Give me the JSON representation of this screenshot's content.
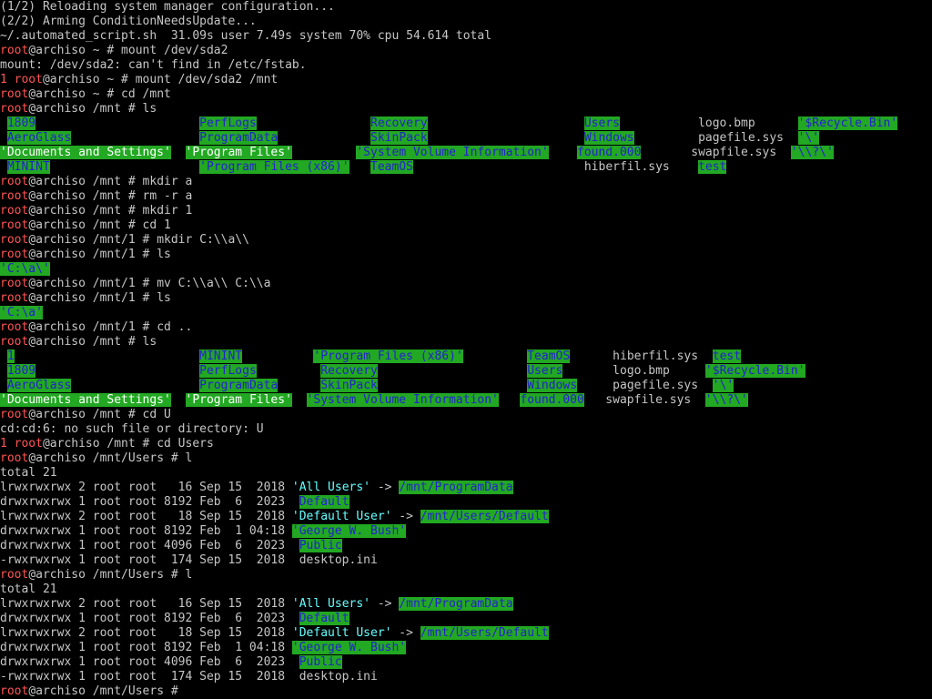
{
  "terminal": {
    "lines": [
      [
        {
          "t": "(1/2) Reloading system manager configuration..."
        }
      ],
      [
        {
          "t": "(2/2) Arming ConditionNeedsUpdate..."
        }
      ],
      [
        {
          "t": "~/.automated_script.sh  31.09s user 7.49s system 70% cpu 54.614 total"
        }
      ],
      [
        {
          "t": "root",
          "c": "user"
        },
        {
          "t": "@archiso ~ # mount /dev/sda2"
        }
      ],
      [
        {
          "t": "mount: /dev/sda2: can't find in /etc/fstab."
        }
      ],
      [
        {
          "t": "1 root",
          "c": "red"
        },
        {
          "t": "@archiso ~ # mount /dev/sda2 /mnt"
        }
      ],
      [
        {
          "t": "root",
          "c": "user"
        },
        {
          "t": "@archiso ~ # cd /mnt"
        }
      ],
      [
        {
          "t": "root",
          "c": "user"
        },
        {
          "t": "@archiso /mnt # ls"
        }
      ],
      [
        {
          "t": " "
        },
        {
          "t": "1809",
          "c": "dir"
        },
        {
          "t": "                       "
        },
        {
          "t": "PerfLogs",
          "c": "dir"
        },
        {
          "t": "                "
        },
        {
          "t": "Recovery",
          "c": "dir"
        },
        {
          "t": "                      "
        },
        {
          "t": "Users",
          "c": "dir"
        },
        {
          "t": "           logo.bmp      "
        },
        {
          "t": "'$Recycle.Bin'",
          "c": "dir"
        }
      ],
      [
        {
          "t": " "
        },
        {
          "t": "AeroGlass",
          "c": "dir"
        },
        {
          "t": "                  "
        },
        {
          "t": "ProgramData",
          "c": "dir"
        },
        {
          "t": "             "
        },
        {
          "t": "SkinPack",
          "c": "dir"
        },
        {
          "t": "                      "
        },
        {
          "t": "Windows",
          "c": "dir"
        },
        {
          "t": "         pagefile.sys  "
        },
        {
          "t": "'\\'",
          "c": "dir"
        }
      ],
      [
        {
          "t": "'Documents and Settings'",
          "c": "qdir"
        },
        {
          "t": "  "
        },
        {
          "t": "'Program Files'",
          "c": "qdir"
        },
        {
          "t": "         "
        },
        {
          "t": "'System Volume Information'",
          "c": "dir"
        },
        {
          "t": "    "
        },
        {
          "t": "found.000",
          "c": "dir"
        },
        {
          "t": "       swapfile.sys  "
        },
        {
          "t": "'\\\\?\\'",
          "c": "dir"
        }
      ],
      [
        {
          "t": " "
        },
        {
          "t": "MININT",
          "c": "dir"
        },
        {
          "t": "                     "
        },
        {
          "t": "'Program Files (x86)'",
          "c": "dir"
        },
        {
          "t": "   "
        },
        {
          "t": "TeamOS",
          "c": "dir"
        },
        {
          "t": "                        hiberfil.sys    "
        },
        {
          "t": "test",
          "c": "dir"
        }
      ],
      [
        {
          "t": "root",
          "c": "user"
        },
        {
          "t": "@archiso /mnt # mkdir a"
        }
      ],
      [
        {
          "t": "root",
          "c": "user"
        },
        {
          "t": "@archiso /mnt # rm -r a"
        }
      ],
      [
        {
          "t": "root",
          "c": "user"
        },
        {
          "t": "@archiso /mnt # mkdir 1"
        }
      ],
      [
        {
          "t": "root",
          "c": "user"
        },
        {
          "t": "@archiso /mnt # cd 1"
        }
      ],
      [
        {
          "t": "root",
          "c": "user"
        },
        {
          "t": "@archiso /mnt/1 # mkdir C:\\\\a\\\\"
        }
      ],
      [
        {
          "t": "root",
          "c": "user"
        },
        {
          "t": "@archiso /mnt/1 # ls"
        }
      ],
      [
        {
          "t": "'C:\\a\\'",
          "c": "dir"
        }
      ],
      [
        {
          "t": "root",
          "c": "user"
        },
        {
          "t": "@archiso /mnt/1 # mv C:\\\\a\\\\ C:\\\\a"
        }
      ],
      [
        {
          "t": "root",
          "c": "user"
        },
        {
          "t": "@archiso /mnt/1 # ls"
        }
      ],
      [
        {
          "t": "'C:\\a'",
          "c": "dir"
        }
      ],
      [
        {
          "t": "root",
          "c": "user"
        },
        {
          "t": "@archiso /mnt/1 # cd .."
        }
      ],
      [
        {
          "t": "root",
          "c": "user"
        },
        {
          "t": "@archiso /mnt # ls"
        }
      ],
      [
        {
          "t": " "
        },
        {
          "t": "1",
          "c": "dir"
        },
        {
          "t": "                          "
        },
        {
          "t": "MININT",
          "c": "dir"
        },
        {
          "t": "          "
        },
        {
          "t": "'Program Files (x86)'",
          "c": "dir"
        },
        {
          "t": "         "
        },
        {
          "t": "TeamOS",
          "c": "dir"
        },
        {
          "t": "      hiberfil.sys  "
        },
        {
          "t": "test",
          "c": "dir"
        }
      ],
      [
        {
          "t": " "
        },
        {
          "t": "1809",
          "c": "dir"
        },
        {
          "t": "                       "
        },
        {
          "t": "PerfLogs",
          "c": "dir"
        },
        {
          "t": "         "
        },
        {
          "t": "Recovery",
          "c": "dir"
        },
        {
          "t": "                     "
        },
        {
          "t": "Users",
          "c": "dir"
        },
        {
          "t": "       logo.bmp     "
        },
        {
          "t": "'$Recycle.Bin'",
          "c": "dir"
        }
      ],
      [
        {
          "t": " "
        },
        {
          "t": "AeroGlass",
          "c": "dir"
        },
        {
          "t": "                  "
        },
        {
          "t": "ProgramData",
          "c": "dir"
        },
        {
          "t": "      "
        },
        {
          "t": "SkinPack",
          "c": "dir"
        },
        {
          "t": "                     "
        },
        {
          "t": "Windows",
          "c": "dir"
        },
        {
          "t": "     pagefile.sys  "
        },
        {
          "t": "'\\'",
          "c": "dir"
        }
      ],
      [
        {
          "t": "'Documents and Settings'",
          "c": "qdir"
        },
        {
          "t": "  "
        },
        {
          "t": "'Program Files'",
          "c": "qdir"
        },
        {
          "t": "  "
        },
        {
          "t": "'System Volume Information'",
          "c": "dir"
        },
        {
          "t": "   "
        },
        {
          "t": "found.000",
          "c": "dir"
        },
        {
          "t": "   swapfile.sys  "
        },
        {
          "t": "'\\\\?\\'",
          "c": "dir"
        }
      ],
      [
        {
          "t": "root",
          "c": "user"
        },
        {
          "t": "@archiso /mnt # cd U"
        }
      ],
      [
        {
          "t": "cd:cd:6: no such file or directory: U"
        }
      ],
      [
        {
          "t": "1 root",
          "c": "red"
        },
        {
          "t": "@archiso /mnt # cd Users"
        }
      ],
      [
        {
          "t": "root",
          "c": "user"
        },
        {
          "t": "@archiso /mnt/Users # l"
        }
      ],
      [
        {
          "t": "total 21"
        }
      ],
      [
        {
          "t": "lrwxrwxrwx 2 root root   16 Sep 15  2018 "
        },
        {
          "t": "'All Users'",
          "c": "cyan"
        },
        {
          "t": " -> "
        },
        {
          "t": "/mnt/ProgramData",
          "c": "link"
        }
      ],
      [
        {
          "t": "drwxrwxrwx 1 root root 8192 Feb  6  2023  "
        },
        {
          "t": "Default",
          "c": "dir"
        }
      ],
      [
        {
          "t": "lrwxrwxrwx 2 root root   18 Sep 15  2018 "
        },
        {
          "t": "'Default User'",
          "c": "cyan"
        },
        {
          "t": " -> "
        },
        {
          "t": "/mnt/Users/Default",
          "c": "link"
        }
      ],
      [
        {
          "t": "drwxrwxrwx 1 root root 8192 Feb  1 04:18 "
        },
        {
          "t": "'George W. Bush'",
          "c": "dir"
        }
      ],
      [
        {
          "t": "drwxrwxrwx 1 root root 4096 Feb  6  2023  "
        },
        {
          "t": "Public",
          "c": "dir"
        }
      ],
      [
        {
          "t": "-rwxrwxrwx 1 root root  174 Sep 15  2018  desktop.ini"
        }
      ],
      [
        {
          "t": "root",
          "c": "user"
        },
        {
          "t": "@archiso /mnt/Users # l"
        }
      ],
      [
        {
          "t": "total 21"
        }
      ],
      [
        {
          "t": "lrwxrwxrwx 2 root root   16 Sep 15  2018 "
        },
        {
          "t": "'All Users'",
          "c": "cyan"
        },
        {
          "t": " -> "
        },
        {
          "t": "/mnt/ProgramData",
          "c": "link"
        }
      ],
      [
        {
          "t": "drwxrwxrwx 1 root root 8192 Feb  6  2023  "
        },
        {
          "t": "Default",
          "c": "dir"
        }
      ],
      [
        {
          "t": "lrwxrwxrwx 2 root root   18 Sep 15  2018 "
        },
        {
          "t": "'Default User'",
          "c": "cyan"
        },
        {
          "t": " -> "
        },
        {
          "t": "/mnt/Users/Default",
          "c": "link"
        }
      ],
      [
        {
          "t": "drwxrwxrwx 1 root root 8192 Feb  1 04:18 "
        },
        {
          "t": "'George W. Bush'",
          "c": "dir"
        }
      ],
      [
        {
          "t": "drwxrwxrwx 1 root root 4096 Feb  6  2023  "
        },
        {
          "t": "Public",
          "c": "dir"
        }
      ],
      [
        {
          "t": "-rwxrwxrwx 1 root root  174 Sep 15  2018  desktop.ini"
        }
      ],
      [
        {
          "t": "root",
          "c": "user"
        },
        {
          "t": "@archiso /mnt/Users # "
        }
      ]
    ]
  },
  "colors": {
    "background": "#000000",
    "foreground": "#c6c6c6",
    "prompt_user": "#ff5555",
    "directory_bg": "#22a822",
    "directory_fg": "#2222cc",
    "symlink": "#66ffff"
  }
}
